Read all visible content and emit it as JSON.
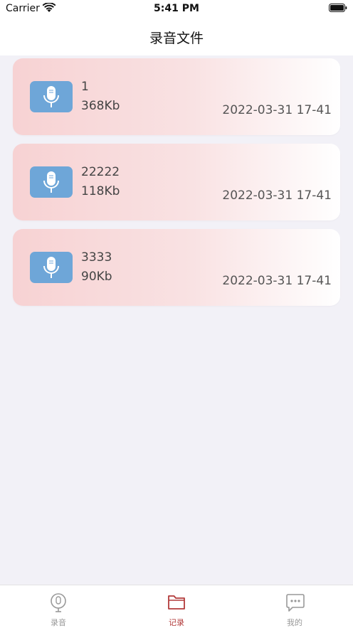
{
  "status_bar": {
    "carrier": "Carrier",
    "time": "5:41 PM"
  },
  "nav": {
    "title": "录音文件"
  },
  "recordings": [
    {
      "name": "1",
      "size": "368Kb",
      "date": "2022-03-31 17-41",
      "icon": "microphone-icon"
    },
    {
      "name": "22222",
      "size": "118Kb",
      "date": "2022-03-31 17-41",
      "icon": "microphone-icon"
    },
    {
      "name": "3333",
      "size": "90Kb",
      "date": "2022-03-31 17-41",
      "icon": "microphone-icon"
    }
  ],
  "tabs": [
    {
      "label": "录音",
      "icon": "microphone-outline-icon",
      "active": false
    },
    {
      "label": "记录",
      "icon": "folder-icon",
      "active": true
    },
    {
      "label": "我的",
      "icon": "chat-bubble-icon",
      "active": false
    }
  ],
  "colors": {
    "accent": "#b23a3a",
    "icon_bg": "#6ea6d8",
    "card_start": "#f7d2d3",
    "background": "#f2f1f7"
  }
}
